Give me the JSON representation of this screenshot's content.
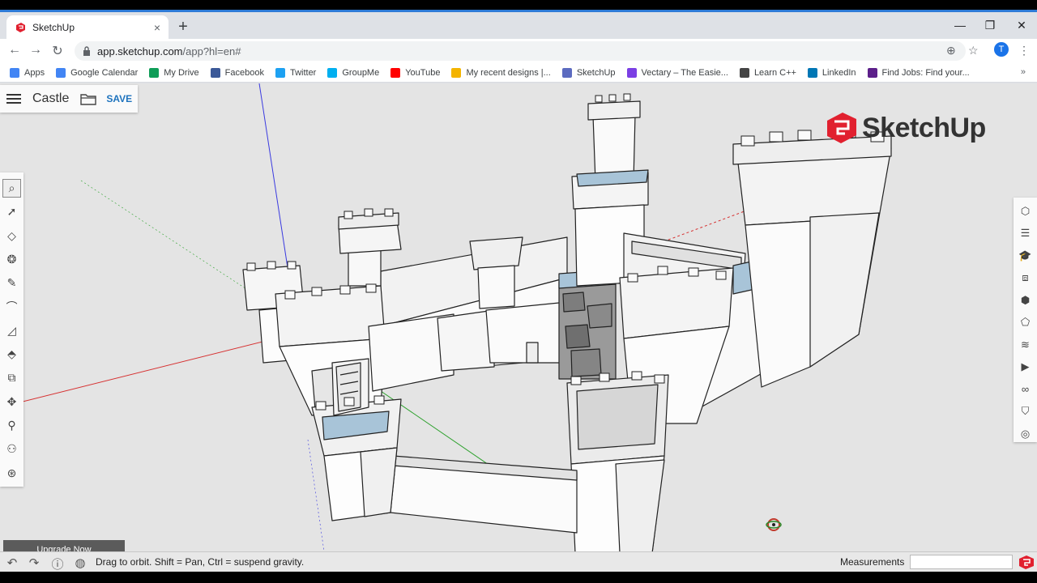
{
  "browser": {
    "tab_title": "SketchUp",
    "tab_close": "×",
    "new_tab": "+",
    "window_controls": {
      "minimize": "—",
      "restore": "❐",
      "close": "✕"
    },
    "nav": {
      "back": "←",
      "forward": "→",
      "reload": "↻"
    },
    "url_host": "app.sketchup.com",
    "url_path": "/app?hl=en#",
    "avatar_letter": "T",
    "bookmarks": [
      {
        "label": "Apps",
        "color": "#4285f4"
      },
      {
        "label": "Google Calendar",
        "color": "#4285f4"
      },
      {
        "label": "My Drive",
        "color": "#0f9d58"
      },
      {
        "label": "Facebook",
        "color": "#3b5998"
      },
      {
        "label": "Twitter",
        "color": "#1da1f2"
      },
      {
        "label": "GroupMe",
        "color": "#00aff0"
      },
      {
        "label": "YouTube",
        "color": "#ff0000"
      },
      {
        "label": "My recent designs |...",
        "color": "#f4b400"
      },
      {
        "label": "SketchUp",
        "color": "#5c6bc0"
      },
      {
        "label": "Vectary – The Easie...",
        "color": "#7b3fe4"
      },
      {
        "label": "Learn C++",
        "color": "#444444"
      },
      {
        "label": "LinkedIn",
        "color": "#0077b5"
      },
      {
        "label": "Find Jobs: Find your...",
        "color": "#5c1f8a"
      }
    ],
    "bookmarks_more": "»"
  },
  "app": {
    "document_title": "Castle",
    "save_label": "SAVE",
    "logo_text": "SketchUp",
    "upgrade_label": "Upgrade Now",
    "brand_color": "#e1202f",
    "left_tools": [
      {
        "name": "search-tool",
        "glyph": "⌕"
      },
      {
        "name": "select-tool",
        "glyph": "➚"
      },
      {
        "name": "eraser-tool",
        "glyph": "◇"
      },
      {
        "name": "paint-tool",
        "glyph": "❂"
      },
      {
        "name": "pencil-tool",
        "glyph": "✎"
      },
      {
        "name": "arc-tool",
        "glyph": "⌒"
      },
      {
        "name": "rectangle-tool",
        "glyph": "◿"
      },
      {
        "name": "push-pull-tool",
        "glyph": "⬘"
      },
      {
        "name": "offset-tool",
        "glyph": "⧉"
      },
      {
        "name": "move-tool",
        "glyph": "✥"
      },
      {
        "name": "tape-measure-tool",
        "glyph": "⚲"
      },
      {
        "name": "walk-tool",
        "glyph": "⚇"
      },
      {
        "name": "orbit-tool",
        "glyph": "⊛"
      }
    ],
    "right_tools": [
      {
        "name": "entity-info-icon",
        "glyph": "⬡"
      },
      {
        "name": "outliner-icon",
        "glyph": "☰"
      },
      {
        "name": "instructor-icon",
        "glyph": "🎓"
      },
      {
        "name": "components-icon",
        "glyph": "⧈"
      },
      {
        "name": "materials-icon",
        "glyph": "⬢"
      },
      {
        "name": "styles-icon",
        "glyph": "⬠"
      },
      {
        "name": "layers-icon",
        "glyph": "≋"
      },
      {
        "name": "scenes-icon",
        "glyph": "▶"
      },
      {
        "name": "display-icon",
        "glyph": "∞"
      },
      {
        "name": "solid-inspector-icon",
        "glyph": "⛉"
      },
      {
        "name": "extension-icon",
        "glyph": "◎"
      }
    ],
    "status": {
      "hint": "Drag to orbit. Shift = Pan, Ctrl = suspend gravity.",
      "measurements_label": "Measurements",
      "measurements_value": ""
    }
  }
}
